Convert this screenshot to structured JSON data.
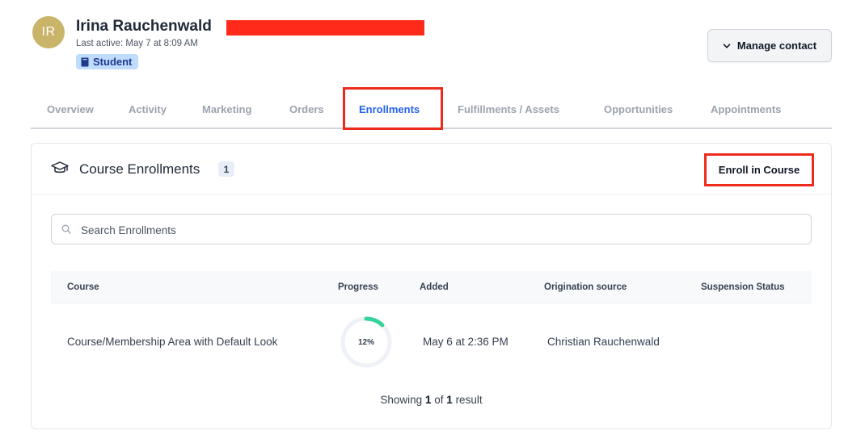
{
  "contact": {
    "initials": "IR",
    "name": "Irina Rauchenwald",
    "last_active": "Last active: May 7 at 8:09 AM",
    "tag": "Student"
  },
  "actions": {
    "manage_contact": "Manage contact"
  },
  "tabs": [
    {
      "label": "Overview"
    },
    {
      "label": "Activity"
    },
    {
      "label": "Marketing"
    },
    {
      "label": "Orders"
    },
    {
      "label": "Enrollments",
      "active": true
    },
    {
      "label": "Fulfillments / Assets"
    },
    {
      "label": "Opportunities"
    },
    {
      "label": "Appointments"
    }
  ],
  "enrollments": {
    "title": "Course Enrollments",
    "count": "1",
    "enroll_button": "Enroll in Course",
    "search_placeholder": "Search Enrollments",
    "columns": [
      "Course",
      "Progress",
      "Added",
      "Origination source",
      "Suspension Status"
    ],
    "rows": [
      {
        "course": "Course/Membership Area with Default Look",
        "progress_label": "12%",
        "progress": 0.12,
        "added": "May 6 at 2:36 PM",
        "origination_source": "Christian Rauchenwald",
        "suspension_status": ""
      }
    ],
    "showing_prefix": "Showing",
    "showing_from": "1",
    "showing_of": "of",
    "showing_total": "1",
    "showing_suffix": "result"
  },
  "colors": {
    "accent": "#2563eb",
    "highlight": "#ee2a1a",
    "avatar": "#c9b46a",
    "progress": "#34d399"
  }
}
